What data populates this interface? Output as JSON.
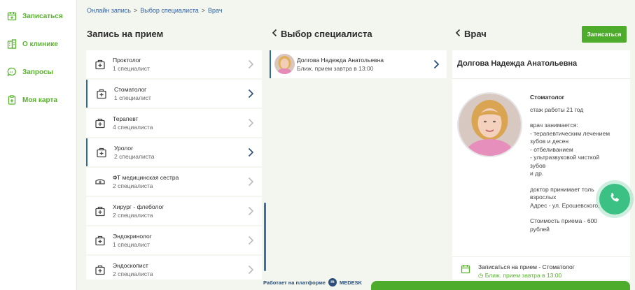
{
  "sidebar": {
    "items": [
      {
        "label": "Записаться",
        "icon": "calendar-icon"
      },
      {
        "label": "О клинике",
        "icon": "building-icon"
      },
      {
        "label": "Запросы",
        "icon": "chat-icon"
      },
      {
        "label": "Моя карта",
        "icon": "medical-card-icon"
      }
    ]
  },
  "breadcrumb": [
    "Онлайн запись",
    "Выбор специалиста",
    "Врач"
  ],
  "col1": {
    "title": "Запись на прием",
    "items": [
      {
        "name": "Проктолог",
        "count": "1 специалист",
        "active": false
      },
      {
        "name": "Стоматолог",
        "count": "1 специалист",
        "active": true
      },
      {
        "name": "Терапевт",
        "count": "4 специалиста",
        "active": false
      },
      {
        "name": "Уролог",
        "count": "2 специалиста",
        "active": true
      },
      {
        "name": "ФТ медицинская сестра",
        "count": "2 специалиста",
        "active": false
      },
      {
        "name": "Хирург - флеболог",
        "count": "2 специалиста",
        "active": false
      },
      {
        "name": "Эндокринолог",
        "count": "1 специалист",
        "active": false
      },
      {
        "name": "Эндоскопист",
        "count": "2 специалиста",
        "active": false
      }
    ]
  },
  "col2": {
    "title": "Выбор специалиста",
    "doctor": {
      "name": "Долгова Надежда Анатольевна",
      "nearest": "Ближ. прием завтра в 13:00"
    }
  },
  "col3": {
    "title": "Врач",
    "signup_label": "Записаться",
    "doctor_name": "Долгова Надежда Анатольевна",
    "specialty": "Стоматолог",
    "experience": "стаж работы 21 год",
    "does_title": "врач занимается:",
    "does_lines": [
      "- терапевтическим лечением",
      "зубов и десен",
      "- отбеливанием",
      "- ультразвуковой чисткой",
      "зубов",
      "и др."
    ],
    "accepts_lines": [
      "доктор принимает толь",
      "взрослых",
      "Адрес - ул. Ерошевского, 2"
    ],
    "price_lines": [
      "Стоимость приема - 600",
      "рублей"
    ],
    "book_label": "Записаться на прием - Стоматолог",
    "book_nearest": "Ближ. прием завтра в 13:00"
  },
  "footer": {
    "text": "Работает на платформе",
    "brand": "MEDESK"
  },
  "colors": {
    "accent": "#4eac2d",
    "link": "#2b62a8",
    "active_border": "#2e6a9e",
    "call": "#3bc184"
  }
}
